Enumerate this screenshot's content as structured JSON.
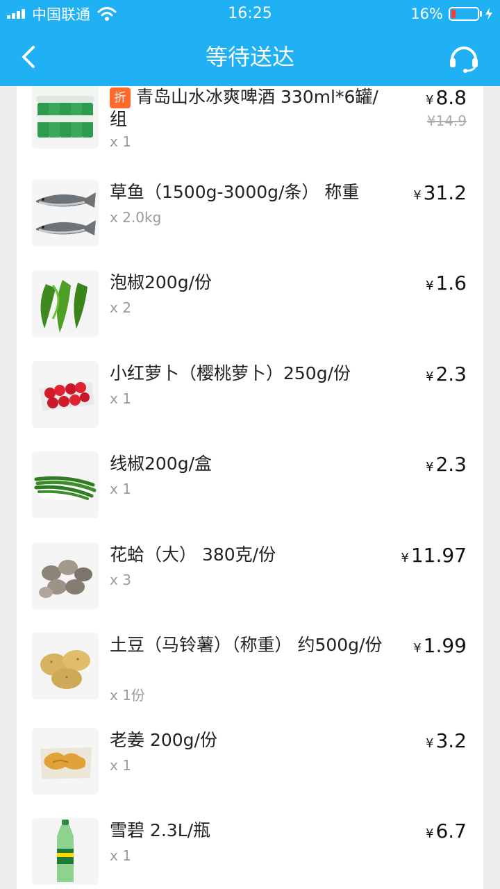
{
  "status_bar": {
    "carrier": "中国联通",
    "time": "16:25",
    "battery": "16%",
    "battery_level": 0.16
  },
  "nav": {
    "title": "等待送达",
    "back_icon": "chevron-left-icon",
    "support_icon": "headset-icon"
  },
  "colors": {
    "header": "#1fb1f4",
    "discount_badge": "#ff6a2a"
  },
  "items": [
    {
      "badge": "折",
      "name": "青岛山水冰爽啤酒 330ml*6罐/组",
      "qty": "x 1",
      "currency": "¥",
      "price": "8.8",
      "original_price": "¥14.9",
      "icon": "beer-cans-icon"
    },
    {
      "name": "草鱼（1500g-3000g/条） 称重",
      "qty": "x 2.0kg",
      "currency": "¥",
      "price": "31.2",
      "icon": "fish-icon"
    },
    {
      "name": "泡椒200g/份",
      "qty": "x 2",
      "currency": "¥",
      "price": "1.6",
      "icon": "green-pepper-icon"
    },
    {
      "name": "小红萝卜（樱桃萝卜）250g/份",
      "qty": "x 1",
      "currency": "¥",
      "price": "2.3",
      "icon": "radish-icon"
    },
    {
      "name": "线椒200g/盒",
      "qty": "x 1",
      "currency": "¥",
      "price": "2.3",
      "icon": "long-pepper-icon"
    },
    {
      "name": "花蛤（大） 380克/份",
      "qty": "x 3",
      "currency": "¥",
      "price": "11.97",
      "icon": "clams-icon"
    },
    {
      "name": "土豆（马铃薯）（称重） 约500g/份",
      "qty": "x 1份",
      "currency": "¥",
      "price": "1.99",
      "icon": "potato-icon"
    },
    {
      "name": "老姜 200g/份",
      "qty": "x 1",
      "currency": "¥",
      "price": "3.2",
      "icon": "ginger-icon"
    },
    {
      "name": "雪碧 2.3L/瓶",
      "qty": "x 1",
      "currency": "¥",
      "price": "6.7",
      "icon": "soda-bottle-icon"
    }
  ]
}
